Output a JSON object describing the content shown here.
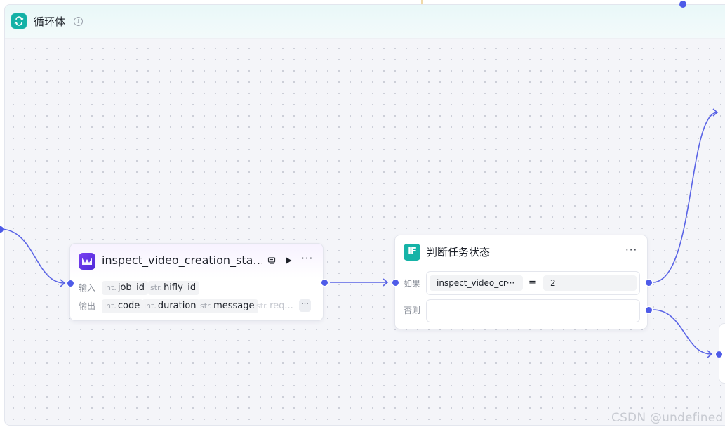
{
  "loop": {
    "title": "循环体",
    "info_glyph": "i"
  },
  "plugin_node": {
    "title": "inspect_video_creation_sta…",
    "input_label": "输入",
    "output_label": "输出",
    "inputs": [
      {
        "type": "int.",
        "name": "job_id"
      },
      {
        "type": "str.",
        "name": "hifly_id"
      }
    ],
    "outputs": [
      {
        "type": "int.",
        "name": "code"
      },
      {
        "type": "int.",
        "name": "duration"
      },
      {
        "type": "str.",
        "name": "message"
      },
      {
        "type": "str.",
        "name": "req..."
      }
    ],
    "more_glyph": "···",
    "tools": {
      "more": "···"
    }
  },
  "condition_node": {
    "icon_text": "IF",
    "title": "判断任务状态",
    "more": "···",
    "if_label": "如果",
    "else_label": "否则",
    "condition": {
      "left": "inspect_video_cr···",
      "operator": "=",
      "right": "2"
    }
  },
  "watermark": "CSDN @undefined",
  "colors": {
    "accent": "#4e5be8",
    "loop_icon": "#14b1a6",
    "condition_icon": "#16b3a7",
    "plugin_icon": "#6a34ea"
  },
  "icons": {
    "loop": "loop-icon",
    "info": "info-icon",
    "plugin": "plugin-logo-icon",
    "debug": "debug-icon",
    "run": "play-icon",
    "more": "more-icon"
  }
}
